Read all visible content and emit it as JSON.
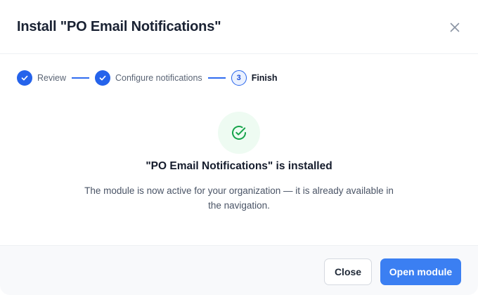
{
  "dialog": {
    "title": "Install \"PO Email Notifications\""
  },
  "stepper": {
    "steps": [
      {
        "label": "Review",
        "state": "complete"
      },
      {
        "label": "Configure notifications",
        "state": "complete"
      },
      {
        "number": "3",
        "label": "Finish",
        "state": "current"
      }
    ]
  },
  "result": {
    "icon": "check-circle-icon",
    "title": "\"PO Email Notifications\" is installed",
    "description": "The module is now active for your organization — it is already available in the navigation."
  },
  "footer": {
    "close_label": "Close",
    "open_label": "Open module"
  },
  "colors": {
    "primary": "#3b7ff2",
    "step_complete": "#2563eb",
    "success": "#16a34a",
    "success_bg": "#eefbf2"
  }
}
